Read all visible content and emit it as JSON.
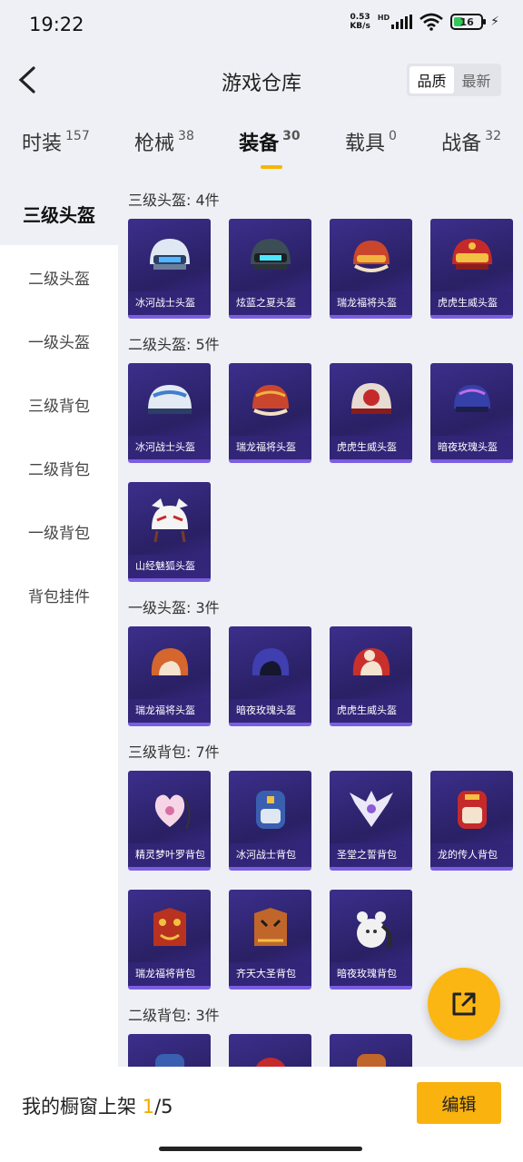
{
  "status_bar": {
    "time": "19:22",
    "net_speed": "0.53",
    "net_unit": "KB/s",
    "hd": "HD",
    "battery": "16"
  },
  "header": {
    "title": "游戏仓库",
    "sort_options": [
      "品质",
      "最新"
    ]
  },
  "tabs": [
    {
      "label": "时装",
      "count": "157"
    },
    {
      "label": "枪械",
      "count": "38"
    },
    {
      "label": "装备",
      "count": "30"
    },
    {
      "label": "载具",
      "count": "0"
    },
    {
      "label": "战备",
      "count": "32"
    }
  ],
  "sidebar": [
    "三级头盔",
    "二级头盔",
    "一级头盔",
    "三级背包",
    "二级背包",
    "一级背包",
    "背包挂件"
  ],
  "sections": [
    {
      "title": "三级头盔: 4件",
      "items": [
        "冰河战士头盔",
        "炫蓝之夏头盔",
        "瑞龙福将头盔",
        "虎虎生威头盔"
      ]
    },
    {
      "title": "二级头盔: 5件",
      "items": [
        "冰河战士头盔",
        "瑞龙福将头盔",
        "虎虎生威头盔",
        "暗夜玫瑰头盔",
        "山经魅狐头盔"
      ]
    },
    {
      "title": "一级头盔: 3件",
      "items": [
        "瑞龙福将头盔",
        "暗夜玫瑰头盔",
        "虎虎生威头盔"
      ]
    },
    {
      "title": "三级背包: 7件",
      "items": [
        "精灵梦叶罗背包",
        "冰河战士背包",
        "圣堂之誓背包",
        "龙的传人背包",
        "瑞龙福将背包",
        "齐天大圣背包",
        "暗夜玫瑰背包"
      ]
    },
    {
      "title": "二级背包: 3件",
      "items": [
        "",
        "",
        ""
      ]
    }
  ],
  "bottom_bar": {
    "label": "我的橱窗上架",
    "current": "1",
    "total": "/5",
    "edit": "编辑"
  },
  "colors": {
    "accent": "#f9b20e",
    "card_bg": "#2f2475"
  }
}
